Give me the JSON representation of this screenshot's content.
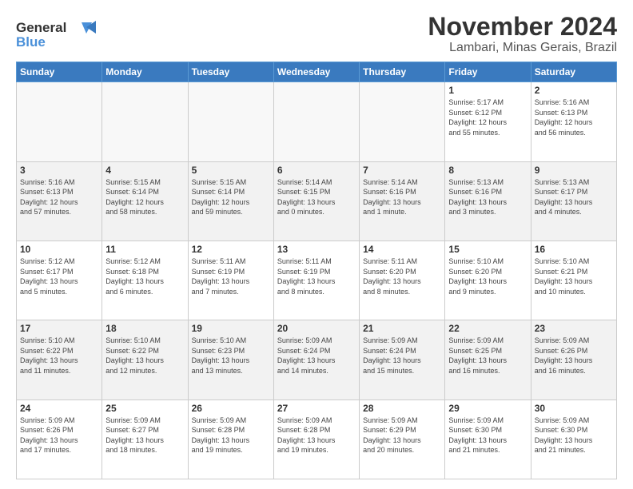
{
  "logo": {
    "line1": "General",
    "line2": "Blue"
  },
  "title": "November 2024",
  "location": "Lambari, Minas Gerais, Brazil",
  "weekdays": [
    "Sunday",
    "Monday",
    "Tuesday",
    "Wednesday",
    "Thursday",
    "Friday",
    "Saturday"
  ],
  "weeks": [
    [
      {
        "day": "",
        "info": ""
      },
      {
        "day": "",
        "info": ""
      },
      {
        "day": "",
        "info": ""
      },
      {
        "day": "",
        "info": ""
      },
      {
        "day": "",
        "info": ""
      },
      {
        "day": "1",
        "info": "Sunrise: 5:17 AM\nSunset: 6:12 PM\nDaylight: 12 hours\nand 55 minutes."
      },
      {
        "day": "2",
        "info": "Sunrise: 5:16 AM\nSunset: 6:13 PM\nDaylight: 12 hours\nand 56 minutes."
      }
    ],
    [
      {
        "day": "3",
        "info": "Sunrise: 5:16 AM\nSunset: 6:13 PM\nDaylight: 12 hours\nand 57 minutes."
      },
      {
        "day": "4",
        "info": "Sunrise: 5:15 AM\nSunset: 6:14 PM\nDaylight: 12 hours\nand 58 minutes."
      },
      {
        "day": "5",
        "info": "Sunrise: 5:15 AM\nSunset: 6:14 PM\nDaylight: 12 hours\nand 59 minutes."
      },
      {
        "day": "6",
        "info": "Sunrise: 5:14 AM\nSunset: 6:15 PM\nDaylight: 13 hours\nand 0 minutes."
      },
      {
        "day": "7",
        "info": "Sunrise: 5:14 AM\nSunset: 6:16 PM\nDaylight: 13 hours\nand 1 minute."
      },
      {
        "day": "8",
        "info": "Sunrise: 5:13 AM\nSunset: 6:16 PM\nDaylight: 13 hours\nand 3 minutes."
      },
      {
        "day": "9",
        "info": "Sunrise: 5:13 AM\nSunset: 6:17 PM\nDaylight: 13 hours\nand 4 minutes."
      }
    ],
    [
      {
        "day": "10",
        "info": "Sunrise: 5:12 AM\nSunset: 6:17 PM\nDaylight: 13 hours\nand 5 minutes."
      },
      {
        "day": "11",
        "info": "Sunrise: 5:12 AM\nSunset: 6:18 PM\nDaylight: 13 hours\nand 6 minutes."
      },
      {
        "day": "12",
        "info": "Sunrise: 5:11 AM\nSunset: 6:19 PM\nDaylight: 13 hours\nand 7 minutes."
      },
      {
        "day": "13",
        "info": "Sunrise: 5:11 AM\nSunset: 6:19 PM\nDaylight: 13 hours\nand 8 minutes."
      },
      {
        "day": "14",
        "info": "Sunrise: 5:11 AM\nSunset: 6:20 PM\nDaylight: 13 hours\nand 8 minutes."
      },
      {
        "day": "15",
        "info": "Sunrise: 5:10 AM\nSunset: 6:20 PM\nDaylight: 13 hours\nand 9 minutes."
      },
      {
        "day": "16",
        "info": "Sunrise: 5:10 AM\nSunset: 6:21 PM\nDaylight: 13 hours\nand 10 minutes."
      }
    ],
    [
      {
        "day": "17",
        "info": "Sunrise: 5:10 AM\nSunset: 6:22 PM\nDaylight: 13 hours\nand 11 minutes."
      },
      {
        "day": "18",
        "info": "Sunrise: 5:10 AM\nSunset: 6:22 PM\nDaylight: 13 hours\nand 12 minutes."
      },
      {
        "day": "19",
        "info": "Sunrise: 5:10 AM\nSunset: 6:23 PM\nDaylight: 13 hours\nand 13 minutes."
      },
      {
        "day": "20",
        "info": "Sunrise: 5:09 AM\nSunset: 6:24 PM\nDaylight: 13 hours\nand 14 minutes."
      },
      {
        "day": "21",
        "info": "Sunrise: 5:09 AM\nSunset: 6:24 PM\nDaylight: 13 hours\nand 15 minutes."
      },
      {
        "day": "22",
        "info": "Sunrise: 5:09 AM\nSunset: 6:25 PM\nDaylight: 13 hours\nand 16 minutes."
      },
      {
        "day": "23",
        "info": "Sunrise: 5:09 AM\nSunset: 6:26 PM\nDaylight: 13 hours\nand 16 minutes."
      }
    ],
    [
      {
        "day": "24",
        "info": "Sunrise: 5:09 AM\nSunset: 6:26 PM\nDaylight: 13 hours\nand 17 minutes."
      },
      {
        "day": "25",
        "info": "Sunrise: 5:09 AM\nSunset: 6:27 PM\nDaylight: 13 hours\nand 18 minutes."
      },
      {
        "day": "26",
        "info": "Sunrise: 5:09 AM\nSunset: 6:28 PM\nDaylight: 13 hours\nand 19 minutes."
      },
      {
        "day": "27",
        "info": "Sunrise: 5:09 AM\nSunset: 6:28 PM\nDaylight: 13 hours\nand 19 minutes."
      },
      {
        "day": "28",
        "info": "Sunrise: 5:09 AM\nSunset: 6:29 PM\nDaylight: 13 hours\nand 20 minutes."
      },
      {
        "day": "29",
        "info": "Sunrise: 5:09 AM\nSunset: 6:30 PM\nDaylight: 13 hours\nand 21 minutes."
      },
      {
        "day": "30",
        "info": "Sunrise: 5:09 AM\nSunset: 6:30 PM\nDaylight: 13 hours\nand 21 minutes."
      }
    ]
  ]
}
